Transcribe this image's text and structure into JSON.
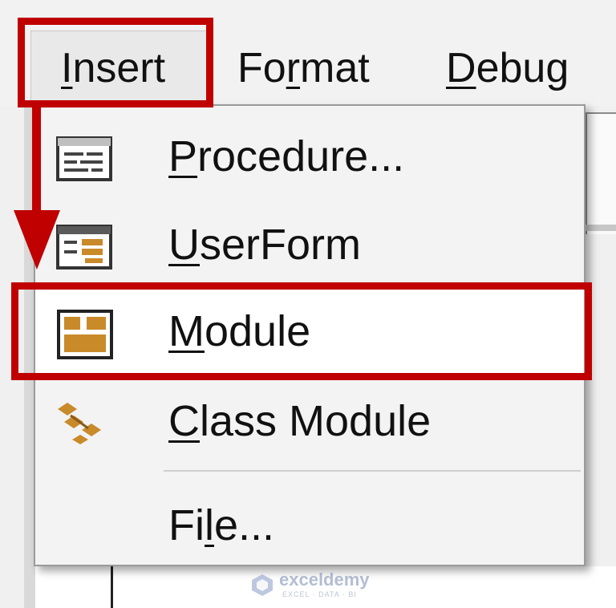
{
  "menubar": {
    "items": [
      {
        "prefix": "",
        "underline": "I",
        "suffix": "nsert"
      },
      {
        "prefix": "Fo",
        "underline": "r",
        "suffix": "mat"
      },
      {
        "prefix": "",
        "underline": "D",
        "suffix": "ebug"
      }
    ]
  },
  "dropdown": {
    "items": [
      {
        "icon": "procedure-icon",
        "prefix": "",
        "underline": "P",
        "suffix": "rocedure..."
      },
      {
        "icon": "userform-icon",
        "prefix": "",
        "underline": "U",
        "suffix": "serForm"
      },
      {
        "icon": "module-icon",
        "prefix": "",
        "underline": "M",
        "suffix": "odule"
      },
      {
        "icon": "class-module-icon",
        "prefix": "",
        "underline": "C",
        "suffix": "lass Module"
      },
      {
        "icon": "",
        "prefix": "Fi",
        "underline": "l",
        "suffix": "e..."
      }
    ]
  },
  "watermark": {
    "name": "exceldemy",
    "tagline": "EXCEL · DATA · BI"
  },
  "colors": {
    "highlight": "#c00000",
    "icon_gold": "#c98a2a"
  }
}
